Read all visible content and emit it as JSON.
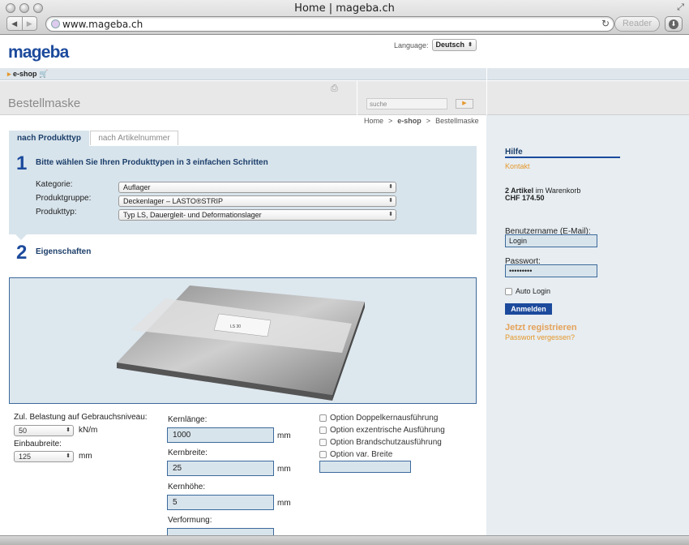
{
  "browser": {
    "window_title": "Home | mageba.ch",
    "url": "www.mageba.ch",
    "reader_label": "Reader",
    "back_glyph": "◀",
    "forward_glyph": "▶",
    "reload_glyph": "↻",
    "fullscreen_glyph": "⤢",
    "download_glyph": "⬇"
  },
  "header": {
    "logo": "mageba",
    "language_label": "Language:",
    "language_value": "Deutsch",
    "eshop_label": "e-shop",
    "page_title": "Bestellmaske",
    "search_placeholder": "suche",
    "search_go_glyph": "▶",
    "print_glyph": "⎙"
  },
  "breadcrumb": [
    "Home",
    ">",
    "e-shop",
    ">",
    "Bestellmaske"
  ],
  "tabs": [
    {
      "label": "nach Produkttyp",
      "active": true
    },
    {
      "label": "nach Artikelnummer",
      "active": false
    }
  ],
  "step1": {
    "number": "1",
    "title": "Bitte wählen Sie Ihren Produkttypen in 3 einfachen Schritten",
    "fields": [
      {
        "label": "Kategorie:",
        "value": "Auflager"
      },
      {
        "label": "Produktgruppe:",
        "value": "Deckenlager – LASTO®STRIP"
      },
      {
        "label": "Produkttyp:",
        "value": "Typ LS, Dauergleit- und Deformationslager"
      }
    ]
  },
  "step2": {
    "number": "2",
    "title": "Eigenschaften",
    "label_text": "LS 30"
  },
  "properties": {
    "load_label": "Zul. Belastung auf Gebrauchsniveau:",
    "load_value": "50",
    "load_unit": "kN/m",
    "width_label": "Einbaubreite:",
    "width_value": "125",
    "width_unit": "mm",
    "core_length_label": "Kernlänge:",
    "core_length_value": "1000",
    "core_width_label": "Kernbreite:",
    "core_width_value": "25",
    "core_height_label": "Kernhöhe:",
    "core_height_value": "5",
    "deformation_label": "Verformung:",
    "mm": "mm",
    "options": [
      "Option Doppelkernausführung",
      "Option exzentrische Ausführung",
      "Option Brandschutzausführung",
      "Option var. Breite"
    ]
  },
  "sidebar": {
    "help_title": "Hilfe",
    "contact": "Kontakt",
    "cart_count": "2 Artikel",
    "cart_in": "im",
    "cart_word": "Warenkorb",
    "cart_total": "CHF 174.50",
    "username_label": "Benutzername (E-Mail):",
    "username_value": "Login",
    "password_label": "Passwort:",
    "password_value": "•••••••••",
    "auto_login": "Auto Login",
    "login_button": "Anmelden",
    "register": "Jetzt registrieren",
    "forgot": "Passwort vergessen?"
  },
  "colors": {
    "brand_blue": "#1c4a9c",
    "accent_orange": "#e5972b",
    "panel_blue": "#d8e4ec"
  }
}
